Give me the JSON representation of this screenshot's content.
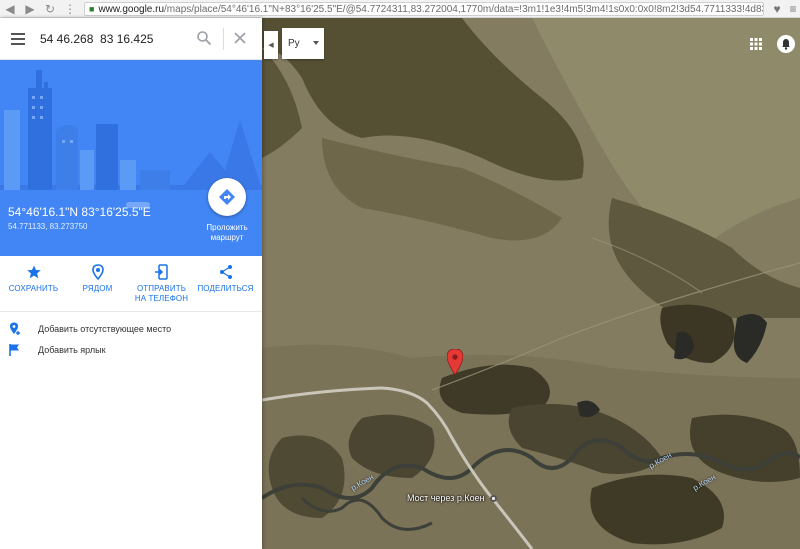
{
  "browser": {
    "url_domain": "www.google.ru",
    "url_path": "/maps/place/54°46'16.1\"N+83°16'25.5\"E/@54.7724311,83.272004,1770m/data=!3m1!1e3!4m5!3m4!1s0x0:0x0!8m2!3d54.7711333!4d83.27375"
  },
  "search": {
    "query": "54 46.268  83 16.425"
  },
  "place": {
    "coords_dms": "54°46'16.1\"N 83°16'25.5\"E",
    "coords_decimal": "54.771133, 83.273750",
    "route_label": "Проложить маршрут"
  },
  "actions": [
    {
      "label": "СОХРАНИТЬ"
    },
    {
      "label": "РЯДОМ"
    },
    {
      "label": "ОТПРАВИТЬ НА ТЕЛЕФОН"
    },
    {
      "label": "ПОДЕЛИТЬСЯ"
    }
  ],
  "list": {
    "add_place": "Добавить отсутствующее место",
    "add_label": "Добавить ярлык"
  },
  "map": {
    "language": "Ру",
    "bridge_label": "Мост через р.Коен",
    "river_label": "р.Коен"
  },
  "colors": {
    "accent": "#4285f4",
    "action_text": "#1a73e8",
    "pin": "#e53935"
  }
}
